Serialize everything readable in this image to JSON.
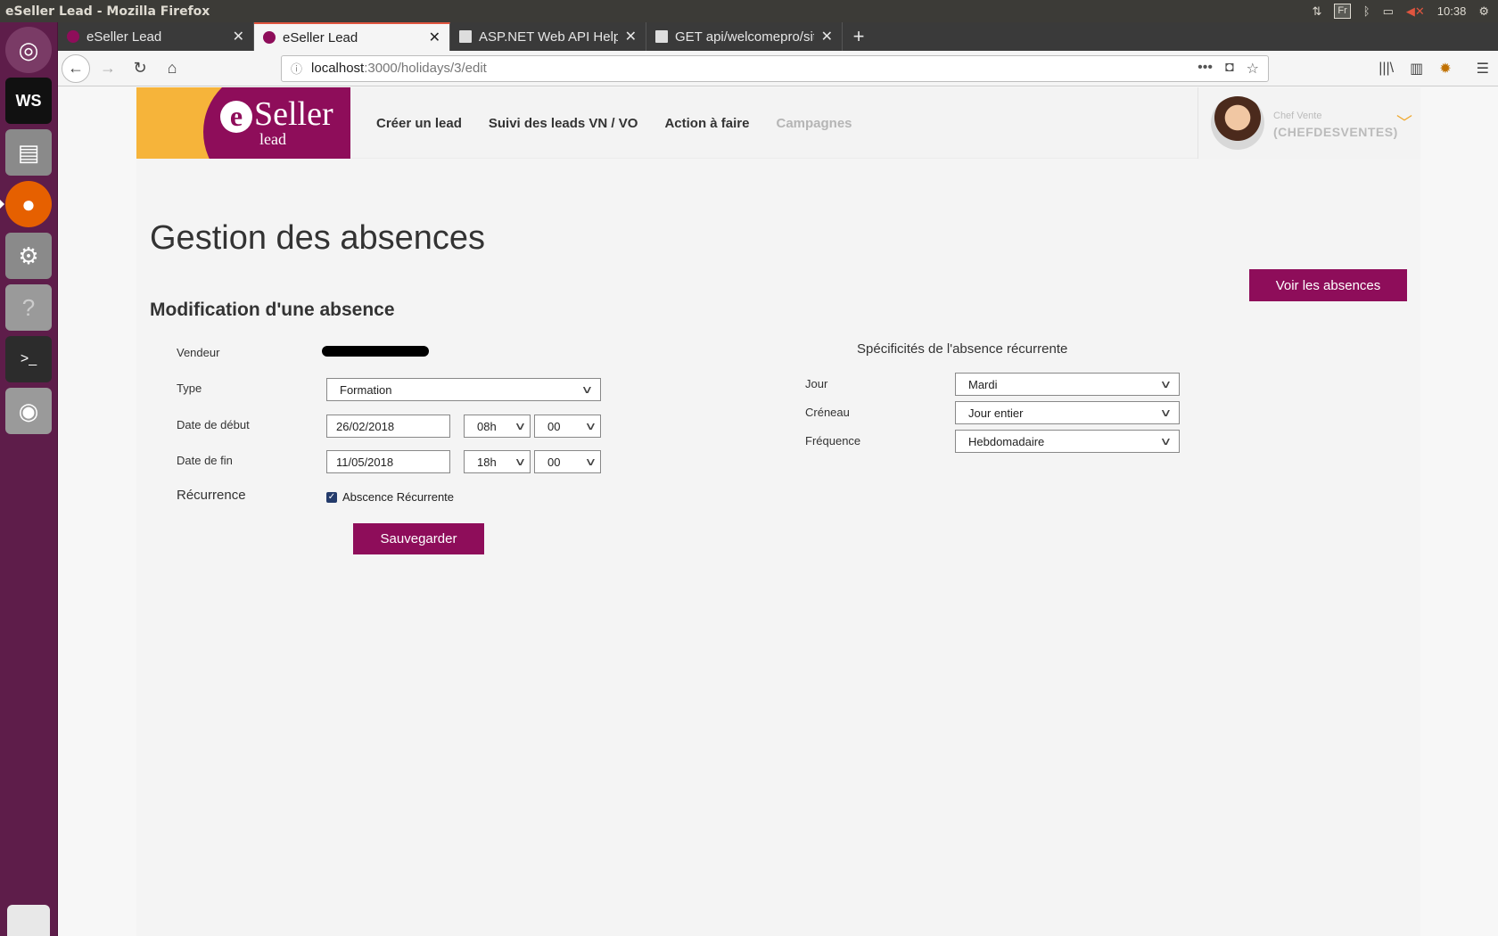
{
  "system": {
    "window_title": "eSeller Lead - Mozilla Firefox",
    "keyboard_layout": "Fr",
    "clock": "10:38"
  },
  "launcher": {
    "items": [
      "ubuntu-dash",
      "webstorm",
      "files",
      "firefox",
      "system-settings",
      "help",
      "terminal",
      "screenshot",
      "trash"
    ]
  },
  "browser": {
    "tabs": [
      {
        "label": "eSeller Lead",
        "active": false
      },
      {
        "label": "eSeller Lead",
        "active": true
      },
      {
        "label": "ASP.NET Web API Help P",
        "active": false
      },
      {
        "label": "GET api/welcomepro/sit",
        "active": false
      }
    ],
    "url_host": "localhost",
    "url_path": ":3000/holidays/3/edit"
  },
  "header": {
    "logo_brand": "Seller",
    "logo_e": "e",
    "logo_sub": "lead",
    "nav": [
      "Créer un lead",
      "Suivi des leads VN / VO",
      "Action à faire",
      "Campagnes"
    ],
    "user_role": "Chef Vente",
    "user_name": "(CHEFDESVENTES)"
  },
  "main": {
    "title": "Gestion des absences",
    "voir_button": "Voir les absences",
    "section_title": "Modification d'une absence",
    "labels": {
      "vendeur": "Vendeur",
      "type": "Type",
      "date_debut": "Date de début",
      "date_fin": "Date de fin",
      "recurrence": "Récurrence"
    },
    "type_value": "Formation",
    "date_debut": {
      "date": "26/02/2018",
      "hour": "08h",
      "minute": "00"
    },
    "date_fin": {
      "date": "11/05/2018",
      "hour": "18h",
      "minute": "00"
    },
    "recurrent_checkbox_label": "Abscence Récurrente",
    "recurrent_checked": true,
    "save_button": "Sauvegarder"
  },
  "recurrence": {
    "title": "Spécificités de l'absence récurrente",
    "jour_label": "Jour",
    "jour_value": "Mardi",
    "creneau_label": "Créneau",
    "creneau_value": "Jour entier",
    "frequence_label": "Fréquence",
    "frequence_value": "Hebdomadaire"
  },
  "colors": {
    "brand_wine": "#8e0d5a",
    "brand_orange": "#f6b43a",
    "launcher_bg": "#5e1d4a"
  }
}
